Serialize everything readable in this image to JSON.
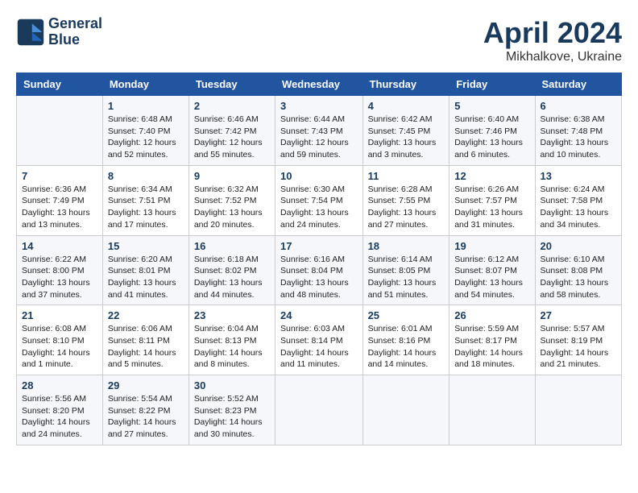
{
  "logo": {
    "line1": "General",
    "line2": "Blue"
  },
  "title": "April 2024",
  "subtitle": "Mikhalkove, Ukraine",
  "days_of_week": [
    "Sunday",
    "Monday",
    "Tuesday",
    "Wednesday",
    "Thursday",
    "Friday",
    "Saturday"
  ],
  "weeks": [
    [
      {
        "day": "",
        "content": ""
      },
      {
        "day": "1",
        "content": "Sunrise: 6:48 AM\nSunset: 7:40 PM\nDaylight: 12 hours\nand 52 minutes."
      },
      {
        "day": "2",
        "content": "Sunrise: 6:46 AM\nSunset: 7:42 PM\nDaylight: 12 hours\nand 55 minutes."
      },
      {
        "day": "3",
        "content": "Sunrise: 6:44 AM\nSunset: 7:43 PM\nDaylight: 12 hours\nand 59 minutes."
      },
      {
        "day": "4",
        "content": "Sunrise: 6:42 AM\nSunset: 7:45 PM\nDaylight: 13 hours\nand 3 minutes."
      },
      {
        "day": "5",
        "content": "Sunrise: 6:40 AM\nSunset: 7:46 PM\nDaylight: 13 hours\nand 6 minutes."
      },
      {
        "day": "6",
        "content": "Sunrise: 6:38 AM\nSunset: 7:48 PM\nDaylight: 13 hours\nand 10 minutes."
      }
    ],
    [
      {
        "day": "7",
        "content": "Sunrise: 6:36 AM\nSunset: 7:49 PM\nDaylight: 13 hours\nand 13 minutes."
      },
      {
        "day": "8",
        "content": "Sunrise: 6:34 AM\nSunset: 7:51 PM\nDaylight: 13 hours\nand 17 minutes."
      },
      {
        "day": "9",
        "content": "Sunrise: 6:32 AM\nSunset: 7:52 PM\nDaylight: 13 hours\nand 20 minutes."
      },
      {
        "day": "10",
        "content": "Sunrise: 6:30 AM\nSunset: 7:54 PM\nDaylight: 13 hours\nand 24 minutes."
      },
      {
        "day": "11",
        "content": "Sunrise: 6:28 AM\nSunset: 7:55 PM\nDaylight: 13 hours\nand 27 minutes."
      },
      {
        "day": "12",
        "content": "Sunrise: 6:26 AM\nSunset: 7:57 PM\nDaylight: 13 hours\nand 31 minutes."
      },
      {
        "day": "13",
        "content": "Sunrise: 6:24 AM\nSunset: 7:58 PM\nDaylight: 13 hours\nand 34 minutes."
      }
    ],
    [
      {
        "day": "14",
        "content": "Sunrise: 6:22 AM\nSunset: 8:00 PM\nDaylight: 13 hours\nand 37 minutes."
      },
      {
        "day": "15",
        "content": "Sunrise: 6:20 AM\nSunset: 8:01 PM\nDaylight: 13 hours\nand 41 minutes."
      },
      {
        "day": "16",
        "content": "Sunrise: 6:18 AM\nSunset: 8:02 PM\nDaylight: 13 hours\nand 44 minutes."
      },
      {
        "day": "17",
        "content": "Sunrise: 6:16 AM\nSunset: 8:04 PM\nDaylight: 13 hours\nand 48 minutes."
      },
      {
        "day": "18",
        "content": "Sunrise: 6:14 AM\nSunset: 8:05 PM\nDaylight: 13 hours\nand 51 minutes."
      },
      {
        "day": "19",
        "content": "Sunrise: 6:12 AM\nSunset: 8:07 PM\nDaylight: 13 hours\nand 54 minutes."
      },
      {
        "day": "20",
        "content": "Sunrise: 6:10 AM\nSunset: 8:08 PM\nDaylight: 13 hours\nand 58 minutes."
      }
    ],
    [
      {
        "day": "21",
        "content": "Sunrise: 6:08 AM\nSunset: 8:10 PM\nDaylight: 14 hours\nand 1 minute."
      },
      {
        "day": "22",
        "content": "Sunrise: 6:06 AM\nSunset: 8:11 PM\nDaylight: 14 hours\nand 5 minutes."
      },
      {
        "day": "23",
        "content": "Sunrise: 6:04 AM\nSunset: 8:13 PM\nDaylight: 14 hours\nand 8 minutes."
      },
      {
        "day": "24",
        "content": "Sunrise: 6:03 AM\nSunset: 8:14 PM\nDaylight: 14 hours\nand 11 minutes."
      },
      {
        "day": "25",
        "content": "Sunrise: 6:01 AM\nSunset: 8:16 PM\nDaylight: 14 hours\nand 14 minutes."
      },
      {
        "day": "26",
        "content": "Sunrise: 5:59 AM\nSunset: 8:17 PM\nDaylight: 14 hours\nand 18 minutes."
      },
      {
        "day": "27",
        "content": "Sunrise: 5:57 AM\nSunset: 8:19 PM\nDaylight: 14 hours\nand 21 minutes."
      }
    ],
    [
      {
        "day": "28",
        "content": "Sunrise: 5:56 AM\nSunset: 8:20 PM\nDaylight: 14 hours\nand 24 minutes."
      },
      {
        "day": "29",
        "content": "Sunrise: 5:54 AM\nSunset: 8:22 PM\nDaylight: 14 hours\nand 27 minutes."
      },
      {
        "day": "30",
        "content": "Sunrise: 5:52 AM\nSunset: 8:23 PM\nDaylight: 14 hours\nand 30 minutes."
      },
      {
        "day": "",
        "content": ""
      },
      {
        "day": "",
        "content": ""
      },
      {
        "day": "",
        "content": ""
      },
      {
        "day": "",
        "content": ""
      }
    ]
  ]
}
